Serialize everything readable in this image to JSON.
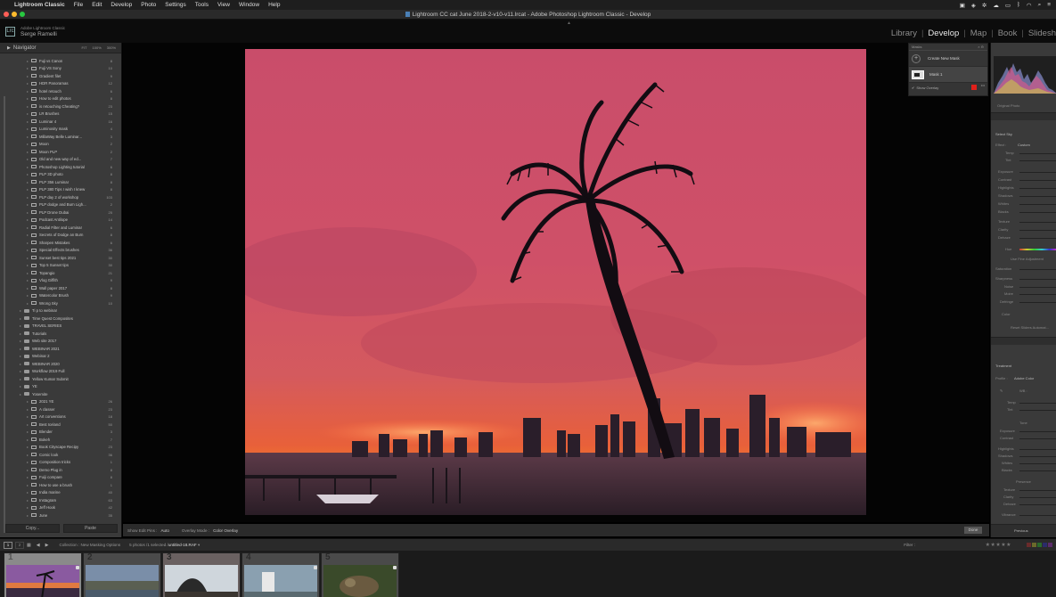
{
  "menubar": {
    "app_name": "Lightroom Classic",
    "items": [
      "File",
      "Edit",
      "Develop",
      "Photo",
      "Settings",
      "Tools",
      "View",
      "Window",
      "Help"
    ]
  },
  "window": {
    "title": "Lightroom CC cat June 2018-2-v10-v11.lrcat - Adobe Photoshop Lightroom Classic - Develop"
  },
  "identity": {
    "product": "Adobe Lightroom Classic",
    "user": "Serge Ramelli",
    "badge": "Lrc"
  },
  "modules": {
    "items": [
      "Library",
      "Develop",
      "Map",
      "Book",
      "Slidesh"
    ],
    "active": "Develop"
  },
  "navigator": {
    "title": "Navigator",
    "zoom_options": [
      "FIT",
      "100%",
      "300%"
    ]
  },
  "collections": [
    {
      "label": "Fuji vs Canon",
      "count": "8",
      "kind": "c"
    },
    {
      "label": "Fuji VS Sony",
      "count": "10",
      "kind": "c"
    },
    {
      "label": "Gradient filet",
      "count": "9",
      "kind": "c"
    },
    {
      "label": "HDR Panoramas",
      "count": "12",
      "kind": "c"
    },
    {
      "label": "hotel retouch",
      "count": "6",
      "kind": "c"
    },
    {
      "label": "How to edit photos",
      "count": "8",
      "kind": "c"
    },
    {
      "label": "is retouching Cheating?",
      "count": "23",
      "kind": "c"
    },
    {
      "label": "LR Brushes",
      "count": "15",
      "kind": "c"
    },
    {
      "label": "Luminar 4",
      "count": "16",
      "kind": "c"
    },
    {
      "label": "Luminosity mask",
      "count": "4",
      "kind": "c"
    },
    {
      "label": "MillaWay Belle Luminar...",
      "count": "3",
      "kind": "c"
    },
    {
      "label": "Moon",
      "count": "2",
      "kind": "c"
    },
    {
      "label": "Moon PLP",
      "count": "2",
      "kind": "c"
    },
    {
      "label": "Old and new way of ed...",
      "count": "7",
      "kind": "c"
    },
    {
      "label": "Photoshop Lighting tutorial",
      "count": "6",
      "kind": "c"
    },
    {
      "label": "PLP 3D photo",
      "count": "8",
      "kind": "c"
    },
    {
      "label": "PLP 356 Luminar",
      "count": "8",
      "kind": "c"
    },
    {
      "label": "PLP 380 Tips I wish I knew",
      "count": "8",
      "kind": "c"
    },
    {
      "label": "PLP day 2 of workshop",
      "count": "103",
      "kind": "c"
    },
    {
      "label": "PLP dodge and Burn Ligh...",
      "count": "2",
      "kind": "c"
    },
    {
      "label": "PLP Drone Dubai",
      "count": "25",
      "kind": "c"
    },
    {
      "label": "Podcast Antilope",
      "count": "14",
      "kind": "c"
    },
    {
      "label": "Radial Filter and Luminar",
      "count": "6",
      "kind": "c"
    },
    {
      "label": "Secrets of Dodge an Burn",
      "count": "8",
      "kind": "c"
    },
    {
      "label": "Sharpen Mistakes",
      "count": "6",
      "kind": "c"
    },
    {
      "label": "Special Effects brushes",
      "count": "36",
      "kind": "c"
    },
    {
      "label": "Sunset best tips 2021",
      "count": "30",
      "kind": "c"
    },
    {
      "label": "Top 5 Sunset tips",
      "count": "30",
      "kind": "c"
    },
    {
      "label": "Topangio",
      "count": "21",
      "kind": "c"
    },
    {
      "label": "Vlog Giffith",
      "count": "9",
      "kind": "c"
    },
    {
      "label": "Wall paper 2017",
      "count": "8",
      "kind": "c"
    },
    {
      "label": "Watercolor Brush",
      "count": "9",
      "kind": "c"
    },
    {
      "label": "Wrong Sky",
      "count": "10",
      "kind": "c"
    },
    {
      "label": "Ti p to webinar",
      "count": "",
      "kind": "s"
    },
    {
      "label": "Time Quest Composites",
      "count": "",
      "kind": "s"
    },
    {
      "label": "TRAVEL SERIES",
      "count": "",
      "kind": "s"
    },
    {
      "label": "Tutorials",
      "count": "",
      "kind": "s"
    },
    {
      "label": "Web site 2017",
      "count": "",
      "kind": "s"
    },
    {
      "label": "WEBINAR 2021",
      "count": "",
      "kind": "s"
    },
    {
      "label": "Webinar 2",
      "count": "",
      "kind": "s"
    },
    {
      "label": "WEBINAR 2020",
      "count": "",
      "kind": "s"
    },
    {
      "label": "Workflow 2019 Full",
      "count": "",
      "kind": "s"
    },
    {
      "label": "Yellow Kumar Submit",
      "count": "",
      "kind": "s"
    },
    {
      "label": "YE",
      "count": "",
      "kind": "s"
    },
    {
      "label": "Yosemite",
      "count": "",
      "kind": "s"
    },
    {
      "label": "2021 YE",
      "count": "26",
      "kind": "c"
    },
    {
      "label": "A classer",
      "count": "23",
      "kind": "c"
    },
    {
      "label": "Art conventions",
      "count": "18",
      "kind": "c"
    },
    {
      "label": "Best Iceland",
      "count": "50",
      "kind": "c"
    },
    {
      "label": "Blender",
      "count": "3",
      "kind": "c"
    },
    {
      "label": "Bokeh",
      "count": "7",
      "kind": "c"
    },
    {
      "label": "Book Cityscape Recipy",
      "count": "23",
      "kind": "c"
    },
    {
      "label": "Comic look",
      "count": "36",
      "kind": "c"
    },
    {
      "label": "Composition tricks",
      "count": "1",
      "kind": "c"
    },
    {
      "label": "Demo Plug in",
      "count": "8",
      "kind": "c"
    },
    {
      "label": "Fuiji compare",
      "count": "8",
      "kind": "c"
    },
    {
      "label": "How to use a brush",
      "count": "1",
      "kind": "c"
    },
    {
      "label": "India marine",
      "count": "40",
      "kind": "c"
    },
    {
      "label": "Instagram",
      "count": "63",
      "kind": "c"
    },
    {
      "label": "Jeff Hook",
      "count": "42",
      "kind": "c"
    },
    {
      "label": "June",
      "count": "35",
      "kind": "c"
    }
  ],
  "left_buttons": {
    "copy": "Copy...",
    "paste": "Paste"
  },
  "toolbar": {
    "show_edit_pins_label": "Show Edit Pins :",
    "show_edit_pins_value": "Auto",
    "overlay_mode_label": "Overlay Mode :",
    "overlay_mode_value": "Color Overlay",
    "done_label": "Done"
  },
  "mask_panel": {
    "title": "Masks",
    "create_label": "Create New Mask",
    "mask_name": "Mask 1",
    "show_overlay_label": "Show Overlay",
    "overlay_color": "#e0201a"
  },
  "right_panel": {
    "original_photo": "Original Photo",
    "select_sky": "Select Sky",
    "effect_label": "Effect :",
    "effect_value": "Custom",
    "labels_a": [
      "Temp",
      "Tint"
    ],
    "labels_b": [
      "Exposure",
      "Contrast",
      "Highlights",
      "Shadows",
      "Whites",
      "Blacks"
    ],
    "labels_c": [
      "Texture",
      "Clarity",
      "Dehaze"
    ],
    "hue": "Hue",
    "fine_adj": "Use Fine Adjustment",
    "labels_d": [
      "Saturation",
      "Sharpness",
      "Noise",
      "Moire",
      "Defringe"
    ],
    "color": "Color",
    "reset": "Reset Sliders Automat...",
    "treatment": "Treatment",
    "profile_label": "Profile :",
    "profile_value": "Adobe Color",
    "wb": "WB :",
    "labels_e": [
      "Temp",
      "Tint"
    ],
    "tone": "Tone",
    "labels_f": [
      "Exposure",
      "Contrast"
    ],
    "labels_g": [
      "Highlights",
      "Shadows",
      "Whites",
      "Blacks"
    ],
    "presence": "Presence",
    "labels_h": [
      "Texture",
      "Clarity",
      "Dehaze"
    ],
    "vibrance": "Vibrance",
    "previous": "Previous"
  },
  "filmbar": {
    "page1": "1",
    "page2": "2",
    "collection": "Collection : New Masking Options",
    "selection_prefix": "5 photos /1 selected /",
    "filename": "untitled-18.RAF",
    "filter": "Filter :",
    "stars": "★★★★★"
  },
  "filmstrip": {
    "numbers": [
      "1",
      "2",
      "3",
      "4",
      "5"
    ]
  },
  "colors": {
    "accent_overlay": "#e0201a",
    "panel_bg": "#3a3a3a",
    "active_module": "#e6e6e6"
  }
}
